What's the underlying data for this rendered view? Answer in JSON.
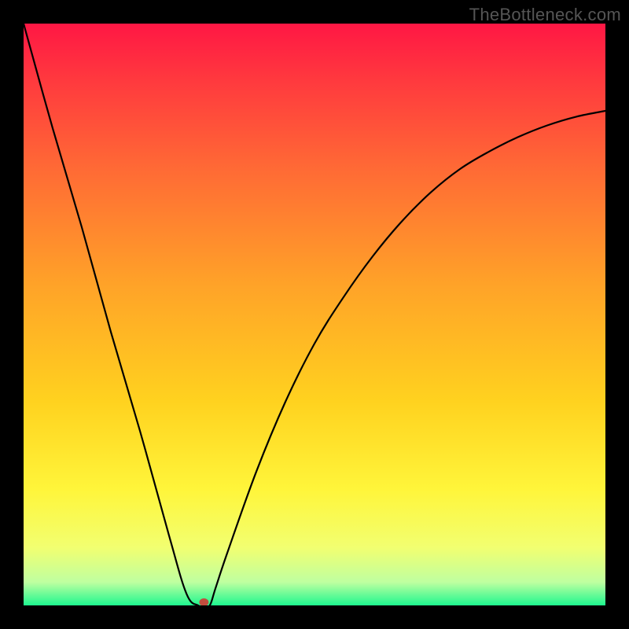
{
  "watermark": "TheBottleneck.com",
  "chart_data": {
    "type": "line",
    "title": "",
    "xlabel": "",
    "ylabel": "",
    "xlim": [
      0,
      100
    ],
    "ylim": [
      0,
      100
    ],
    "x": [
      0,
      5,
      10,
      15,
      20,
      25,
      28,
      30,
      31,
      32,
      33,
      35,
      40,
      45,
      50,
      55,
      60,
      65,
      70,
      75,
      80,
      85,
      90,
      95,
      100
    ],
    "values": [
      100,
      82,
      65,
      47,
      30,
      12,
      2,
      0,
      0,
      0,
      3,
      9,
      23,
      35,
      45,
      53,
      60,
      66,
      71,
      75,
      78,
      80.5,
      82.5,
      84,
      85
    ],
    "annotations": [
      {
        "type": "marker",
        "x": 31,
        "y": 0,
        "shape": "ellipse",
        "color": "#c14d3e"
      }
    ],
    "background": {
      "type": "vertical-gradient",
      "stops": [
        {
          "pos": 0.0,
          "color": "#ff1744"
        },
        {
          "pos": 0.1,
          "color": "#ff3a3e"
        },
        {
          "pos": 0.25,
          "color": "#ff6a35"
        },
        {
          "pos": 0.45,
          "color": "#ffa328"
        },
        {
          "pos": 0.65,
          "color": "#ffd21f"
        },
        {
          "pos": 0.8,
          "color": "#fff53a"
        },
        {
          "pos": 0.9,
          "color": "#f2ff70"
        },
        {
          "pos": 0.96,
          "color": "#bfffa0"
        },
        {
          "pos": 1.0,
          "color": "#1ef78f"
        }
      ]
    }
  }
}
